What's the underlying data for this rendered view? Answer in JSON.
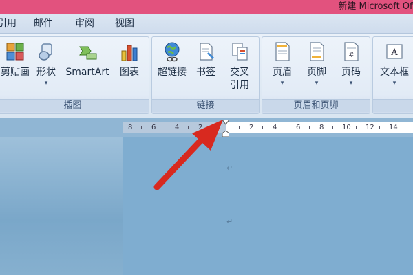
{
  "window": {
    "title": "新建 Microsoft Off"
  },
  "menu": {
    "items": [
      {
        "label": "引用"
      },
      {
        "label": "邮件"
      },
      {
        "label": "审阅"
      },
      {
        "label": "视图"
      }
    ]
  },
  "ribbon": {
    "groups": [
      {
        "label": "插图",
        "buttons": [
          {
            "label": "剪贴画",
            "icon": "clipart-icon"
          },
          {
            "label": "形状",
            "icon": "shapes-icon",
            "dropdown": true
          },
          {
            "label": "SmartArt",
            "icon": "smartart-icon"
          },
          {
            "label": "图表",
            "icon": "chart-icon"
          }
        ]
      },
      {
        "label": "链接",
        "buttons": [
          {
            "label": "超链接",
            "icon": "hyperlink-icon"
          },
          {
            "label": "书签",
            "icon": "bookmark-icon"
          },
          {
            "label": "交叉",
            "label2": "引用",
            "icon": "cross-reference-icon"
          }
        ]
      },
      {
        "label": "页眉和页脚",
        "buttons": [
          {
            "label": "页眉",
            "icon": "header-icon",
            "dropdown": true
          },
          {
            "label": "页脚",
            "icon": "footer-icon",
            "dropdown": true
          },
          {
            "label": "页码",
            "icon": "page-number-icon",
            "dropdown": true
          }
        ]
      },
      {
        "label": "",
        "buttons": [
          {
            "label": "文本框",
            "icon": "textbox-icon",
            "dropdown": true
          }
        ]
      }
    ]
  },
  "ruler": {
    "ticks": [
      "8",
      "6",
      "4",
      "2",
      "2",
      "4",
      "6",
      "8",
      "10",
      "12",
      "14"
    ]
  },
  "document": {
    "paragraph_mark": "↵"
  },
  "annotation": {
    "color": "#d8291f"
  }
}
